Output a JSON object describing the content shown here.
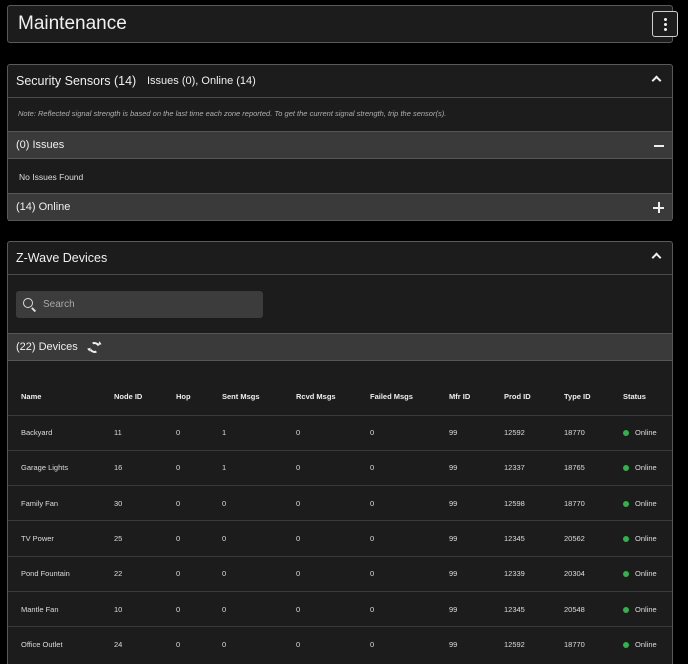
{
  "header": {
    "title": "Maintenance"
  },
  "security": {
    "title": "Security Sensors (14)",
    "summary": "Issues (0), Online (14)",
    "note": "Note: Reflected signal strength is based on the last time each zone reported. To get the current signal strength, trip the sensor(s).",
    "issues_label": "(0) Issues",
    "no_issues_text": "No Issues Found",
    "online_label": "(14) Online"
  },
  "zwave": {
    "title": "Z-Wave Devices",
    "search_placeholder": "Search",
    "devices_label": "(22) Devices",
    "columns": [
      "Name",
      "Node ID",
      "Hop",
      "Sent Msgs",
      "Rcvd Msgs",
      "Failed Msgs",
      "Mfr ID",
      "Prod ID",
      "Type ID",
      "Status"
    ],
    "rows": [
      [
        "Backyard",
        "11",
        "0",
        "1",
        "0",
        "0",
        "99",
        "12592",
        "18770",
        "Online"
      ],
      [
        "Garage Lights",
        "16",
        "0",
        "1",
        "0",
        "0",
        "99",
        "12337",
        "18765",
        "Online"
      ],
      [
        "Family Fan",
        "30",
        "0",
        "0",
        "0",
        "0",
        "99",
        "12598",
        "18770",
        "Online"
      ],
      [
        "TV Power",
        "25",
        "0",
        "0",
        "0",
        "0",
        "99",
        "12345",
        "20562",
        "Online"
      ],
      [
        "Pond Fountain",
        "22",
        "0",
        "0",
        "0",
        "0",
        "99",
        "12339",
        "20304",
        "Online"
      ],
      [
        "Mantle Fan",
        "10",
        "0",
        "0",
        "0",
        "0",
        "99",
        "12345",
        "20548",
        "Online"
      ],
      [
        "Office Outlet",
        "24",
        "0",
        "0",
        "0",
        "0",
        "99",
        "12592",
        "18770",
        "Online"
      ]
    ]
  },
  "colors": {
    "status_online": "#2fb34a",
    "panel": "#1c1c1c",
    "bar": "#3a3a3a"
  },
  "icons": {
    "menu": "kebab-icon",
    "collapse": "chevron-up-icon",
    "search": "search-icon",
    "refresh": "refresh-icon"
  }
}
